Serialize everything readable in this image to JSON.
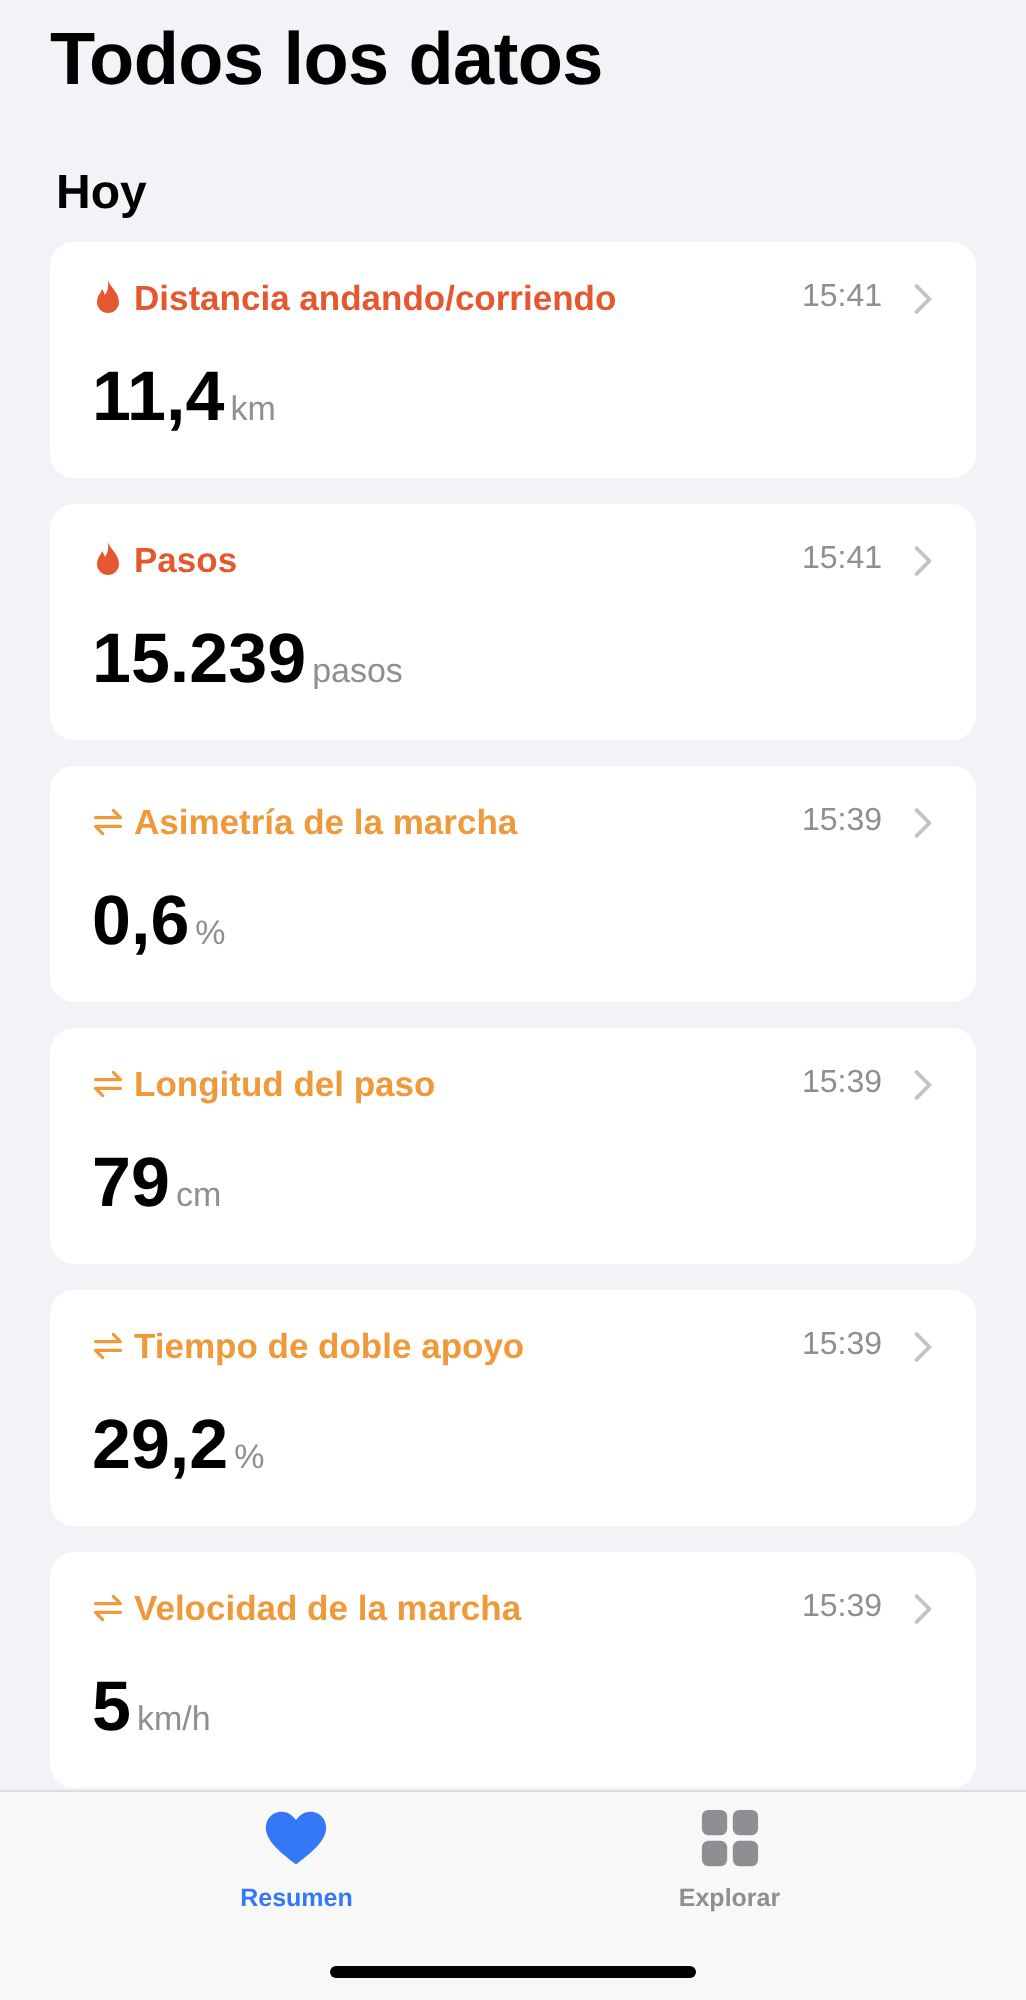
{
  "title": "Todos los datos",
  "section": "Hoy",
  "cards": [
    {
      "kind": "flame",
      "color": "#e4582f",
      "label": "Distancia andando/corriendo",
      "time": "15:41",
      "value": "11,4",
      "unit": "km"
    },
    {
      "kind": "flame",
      "color": "#e4582f",
      "label": "Pasos",
      "time": "15:41",
      "value": "15.239",
      "unit": "pasos"
    },
    {
      "kind": "arrows",
      "color": "#ee9a3a",
      "label": "Asimetría de la marcha",
      "time": "15:39",
      "value": "0,6",
      "unit": "%"
    },
    {
      "kind": "arrows",
      "color": "#ee9a3a",
      "label": "Longitud del paso",
      "time": "15:39",
      "value": "79",
      "unit": "cm"
    },
    {
      "kind": "arrows",
      "color": "#ee9a3a",
      "label": "Tiempo de doble apoyo",
      "time": "15:39",
      "value": "29,2",
      "unit": "%"
    },
    {
      "kind": "arrows",
      "color": "#ee9a3a",
      "label": "Velocidad de la marcha",
      "time": "15:39",
      "value": "5",
      "unit": "km/h"
    }
  ],
  "tabs": [
    {
      "kind": "heart",
      "label": "Resumen",
      "selected": true
    },
    {
      "kind": "grid",
      "label": "Explorar",
      "selected": false
    }
  ]
}
